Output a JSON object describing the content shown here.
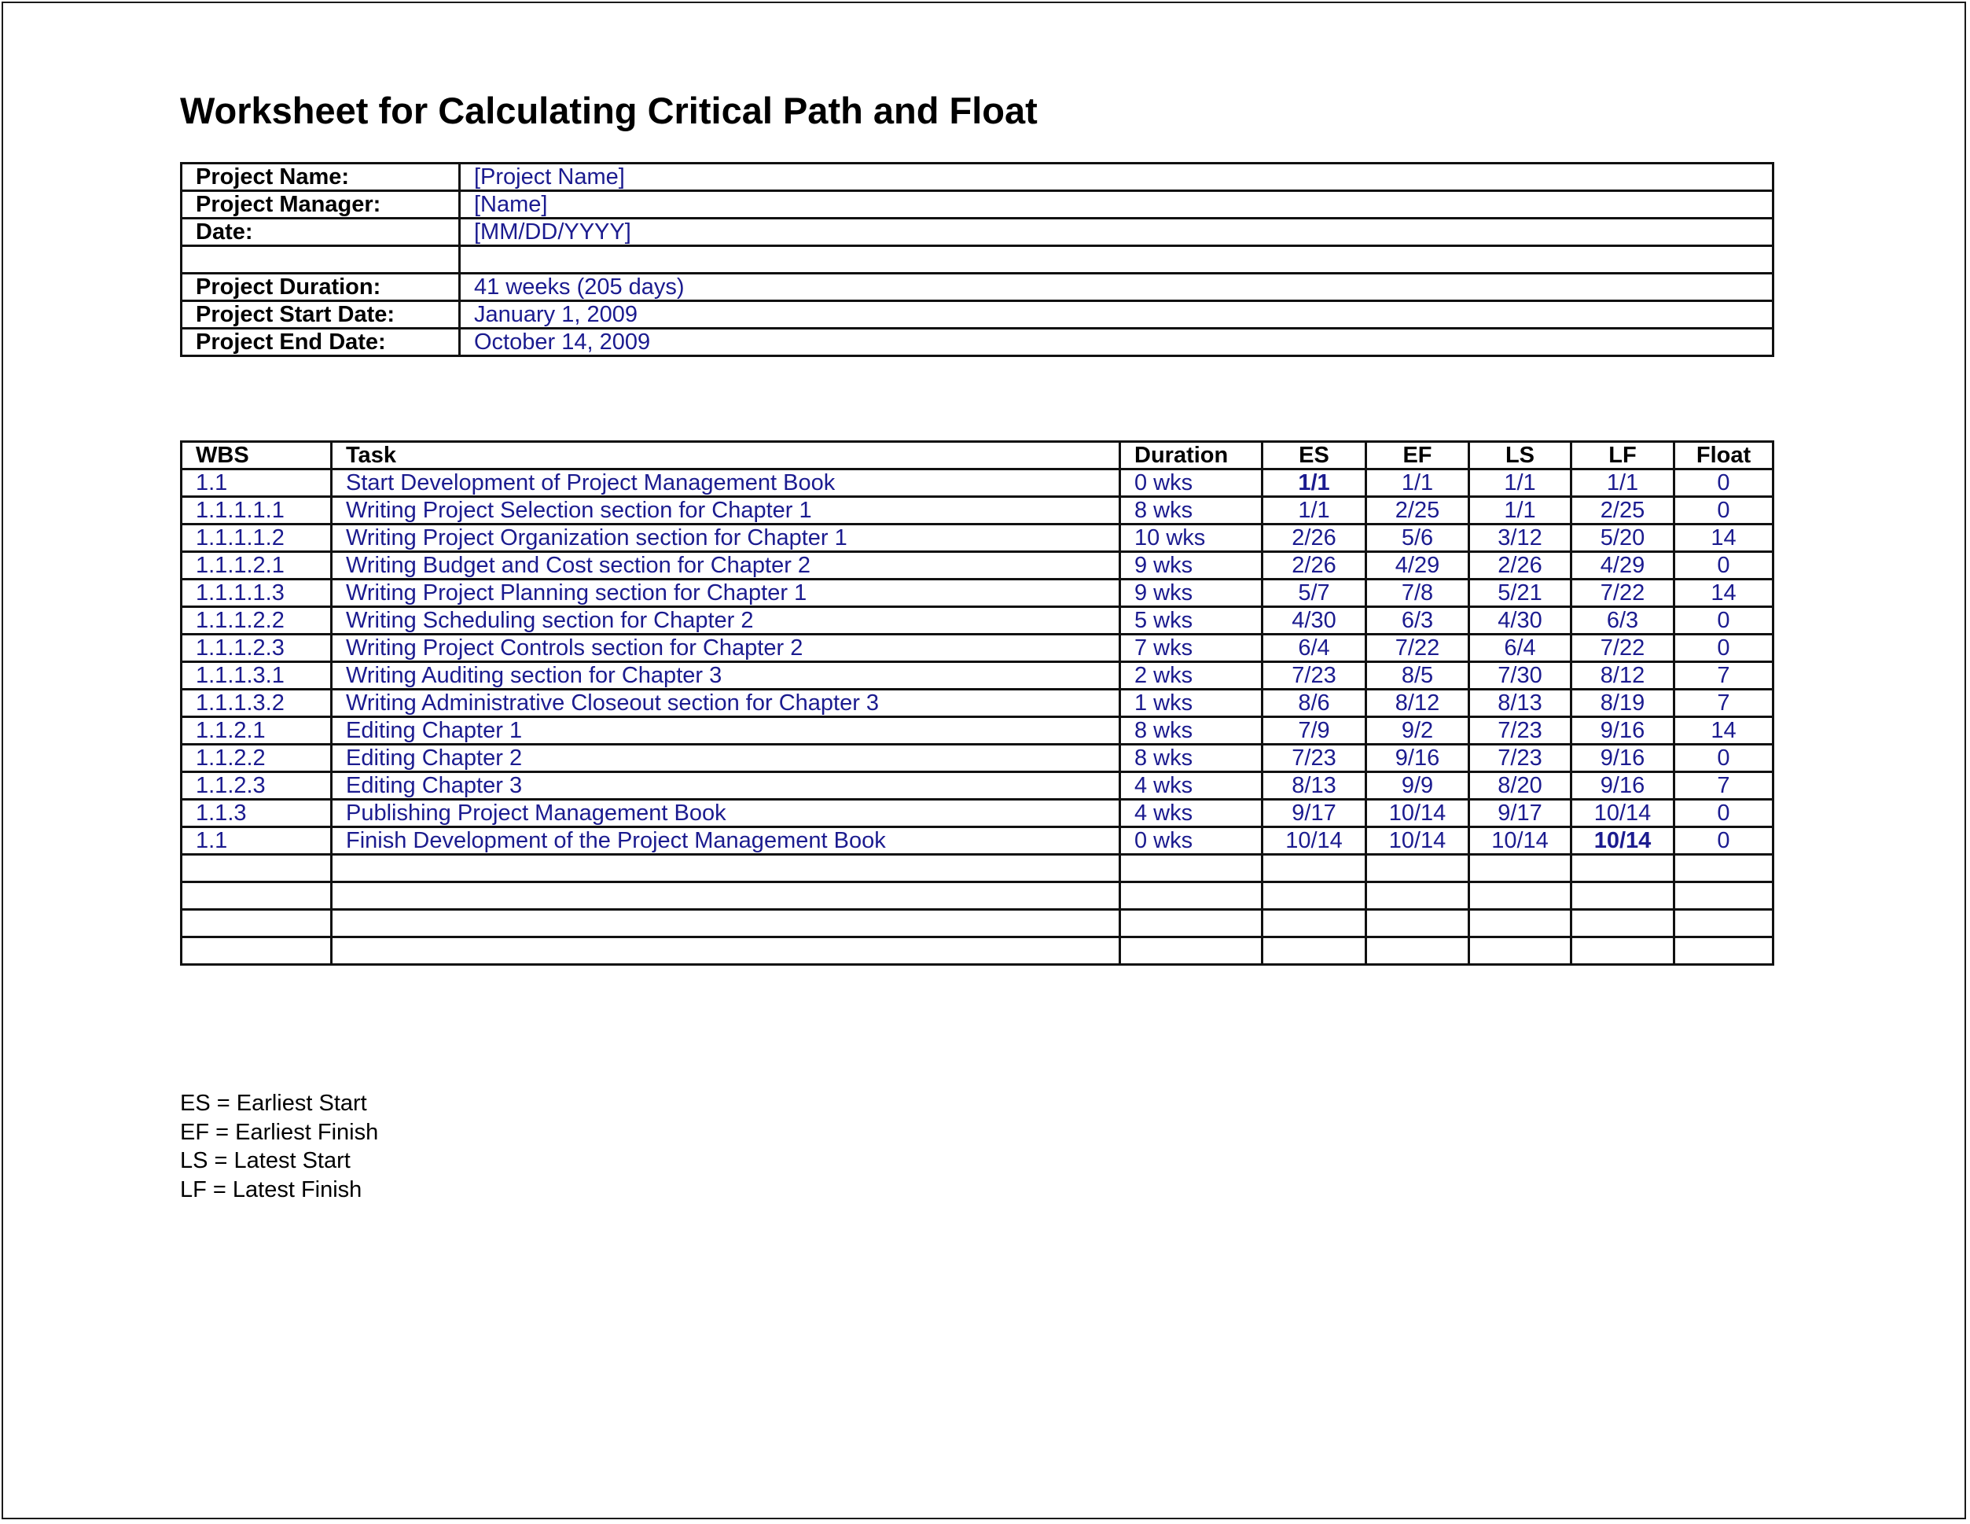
{
  "document": {
    "title": "Worksheet for Calculating Critical Path and Float"
  },
  "project_info": {
    "rows": [
      {
        "label": "Project Name:",
        "value": "[Project Name]"
      },
      {
        "label": "Project Manager:",
        "value": "[Name]"
      },
      {
        "label": "Date:",
        "value": "[MM/DD/YYYY]"
      },
      {
        "label": "",
        "value": ""
      },
      {
        "label": "Project Duration:",
        "value": "41 weeks (205 days)"
      },
      {
        "label": "Project Start Date:",
        "value": "January 1, 2009"
      },
      {
        "label": "Project End Date:",
        "value": "October 14, 2009"
      }
    ]
  },
  "schedule_table": {
    "headers": [
      "WBS",
      "Task",
      "Duration",
      "ES",
      "EF",
      "LS",
      "LF",
      "Float"
    ],
    "rows": [
      {
        "wbs": "1.1",
        "task": "Start Development of Project Management Book",
        "duration": "0 wks",
        "es": "1/1",
        "ef": "1/1",
        "ls": "1/1",
        "lf": "1/1",
        "float": "0",
        "bold": "es"
      },
      {
        "wbs": "1.1.1.1.1",
        "task": "Writing Project Selection section for Chapter 1",
        "duration": "8 wks",
        "es": "1/1",
        "ef": "2/25",
        "ls": "1/1",
        "lf": "2/25",
        "float": "0"
      },
      {
        "wbs": "1.1.1.1.2",
        "task": "Writing Project Organization section for Chapter 1",
        "duration": "10 wks",
        "es": "2/26",
        "ef": "5/6",
        "ls": "3/12",
        "lf": "5/20",
        "float": "14"
      },
      {
        "wbs": "1.1.1.2.1",
        "task": "Writing Budget and Cost section for Chapter 2",
        "duration": "9 wks",
        "es": "2/26",
        "ef": "4/29",
        "ls": "2/26",
        "lf": "4/29",
        "float": "0"
      },
      {
        "wbs": "1.1.1.1.3",
        "task": "Writing Project Planning section for Chapter 1",
        "duration": "9 wks",
        "es": "5/7",
        "ef": "7/8",
        "ls": "5/21",
        "lf": "7/22",
        "float": "14"
      },
      {
        "wbs": "1.1.1.2.2",
        "task": "Writing Scheduling section for Chapter 2",
        "duration": "5 wks",
        "es": "4/30",
        "ef": "6/3",
        "ls": "4/30",
        "lf": "6/3",
        "float": "0"
      },
      {
        "wbs": "1.1.1.2.3",
        "task": "Writing Project Controls section for Chapter 2",
        "duration": "7 wks",
        "es": "6/4",
        "ef": "7/22",
        "ls": "6/4",
        "lf": "7/22",
        "float": "0"
      },
      {
        "wbs": "1.1.1.3.1",
        "task": "Writing Auditing section for Chapter 3",
        "duration": "2 wks",
        "es": "7/23",
        "ef": "8/5",
        "ls": "7/30",
        "lf": "8/12",
        "float": "7"
      },
      {
        "wbs": "1.1.1.3.2",
        "task": "Writing Administrative Closeout section for Chapter 3",
        "duration": "1 wks",
        "es": "8/6",
        "ef": "8/12",
        "ls": "8/13",
        "lf": "8/19",
        "float": "7"
      },
      {
        "wbs": "1.1.2.1",
        "task": "Editing Chapter 1",
        "duration": "8 wks",
        "es": "7/9",
        "ef": "9/2",
        "ls": "7/23",
        "lf": "9/16",
        "float": "14"
      },
      {
        "wbs": "1.1.2.2",
        "task": "Editing Chapter 2",
        "duration": "8 wks",
        "es": "7/23",
        "ef": "9/16",
        "ls": "7/23",
        "lf": "9/16",
        "float": "0"
      },
      {
        "wbs": "1.1.2.3",
        "task": "Editing Chapter 3",
        "duration": "4 wks",
        "es": "8/13",
        "ef": "9/9",
        "ls": "8/20",
        "lf": "9/16",
        "float": "7"
      },
      {
        "wbs": "1.1.3",
        "task": "Publishing Project Management Book",
        "duration": "4 wks",
        "es": "9/17",
        "ef": "10/14",
        "ls": "9/17",
        "lf": "10/14",
        "float": "0"
      },
      {
        "wbs": "1.1",
        "task": "Finish Development of the Project Management Book",
        "duration": "0 wks",
        "es": "10/14",
        "ef": "10/14",
        "ls": "10/14",
        "lf": "10/14",
        "float": "0",
        "bold": "lf"
      },
      {
        "wbs": "",
        "task": "",
        "duration": "",
        "es": "",
        "ef": "",
        "ls": "",
        "lf": "",
        "float": ""
      },
      {
        "wbs": "",
        "task": "",
        "duration": "",
        "es": "",
        "ef": "",
        "ls": "",
        "lf": "",
        "float": ""
      },
      {
        "wbs": "",
        "task": "",
        "duration": "",
        "es": "",
        "ef": "",
        "ls": "",
        "lf": "",
        "float": ""
      },
      {
        "wbs": "",
        "task": "",
        "duration": "",
        "es": "",
        "ef": "",
        "ls": "",
        "lf": "",
        "float": ""
      }
    ]
  },
  "legend": [
    "ES = Earliest Start",
    "EF = Earliest Finish",
    "LS = Latest Start",
    "LF = Latest Finish"
  ],
  "colors": {
    "value_text": "#1b1b8f",
    "label_text": "#000000",
    "border": "#111111"
  }
}
